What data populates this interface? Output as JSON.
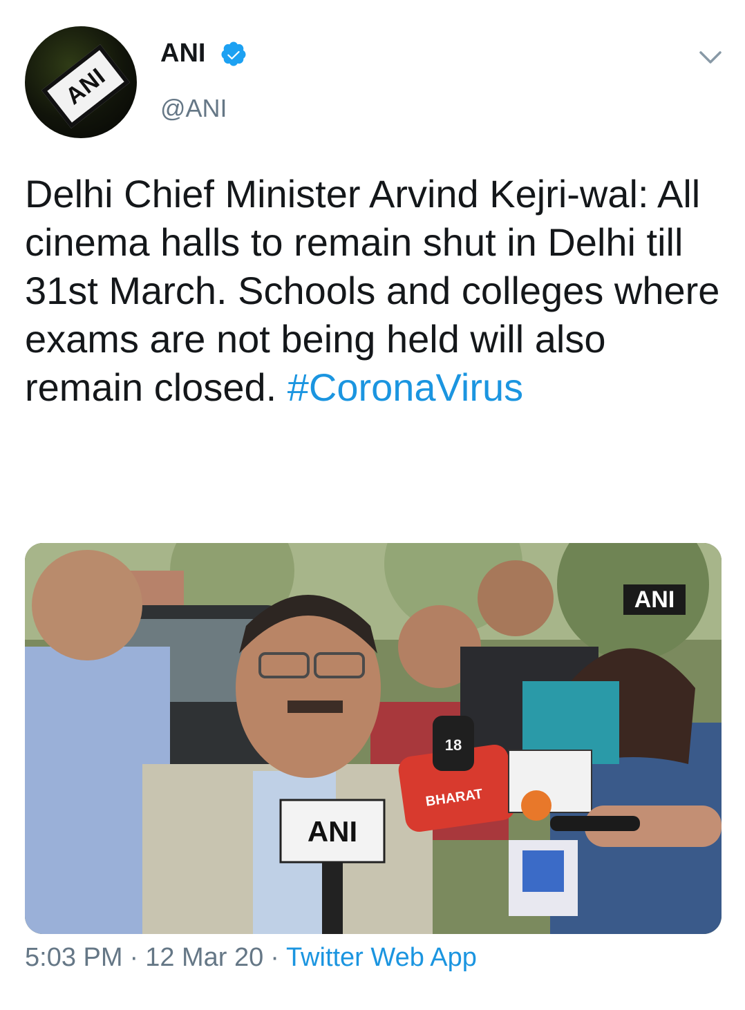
{
  "header": {
    "display_name": "ANI",
    "handle": "@ANI",
    "avatar_logo_text": "ANI",
    "verified_icon": "verified-badge-icon",
    "menu_icon": "chevron-down-icon"
  },
  "tweet": {
    "text": "Delhi Chief Minister Arvind Kejri-wal: All cinema halls to remain shut in Delhi till 31st March. Schools and colleges where exams are not being held will also remain closed. ",
    "hashtag": "#CoronaVirus"
  },
  "media": {
    "watermark": "ANI",
    "mic_labels": [
      "ANI",
      "BHARAT",
      "18"
    ]
  },
  "meta": {
    "time": "5:03 PM",
    "separator": "·",
    "date": "12 Mar 20",
    "source": "Twitter Web App"
  },
  "colors": {
    "link": "#1b95e0",
    "secondary_text": "#657786",
    "primary_text": "#14171a"
  }
}
